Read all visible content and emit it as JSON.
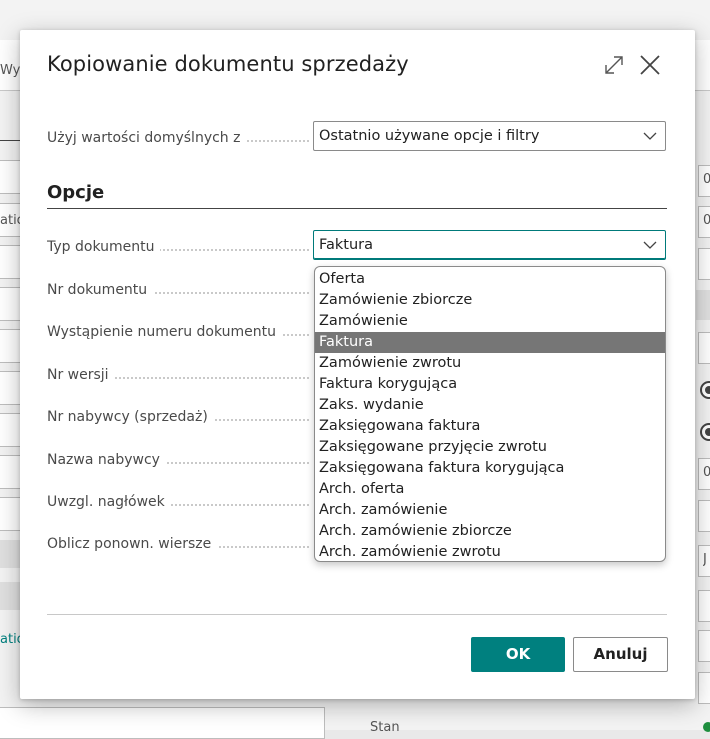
{
  "background": {
    "toolbar_text": "Wyś",
    "left_snippet_1": "atio",
    "left_snippet_2": "ation",
    "right_snippet_1": "0",
    "right_snippet_2": "0",
    "right_snippet_3": "0",
    "right_snippet_4": "J",
    "bottom_label": "Stan"
  },
  "dialog": {
    "title": "Kopiowanie dokumentu sprzedaży",
    "defaults_label": "Użyj wartości domyślnych z",
    "defaults_value": "Ostatnio używane opcje i filtry",
    "section_title": "Opcje",
    "fields": [
      {
        "label": "Typ dokumentu",
        "value": "Faktura"
      },
      {
        "label": "Nr dokumentu"
      },
      {
        "label": "Wystąpienie numeru dokumentu"
      },
      {
        "label": "Nr wersji"
      },
      {
        "label": "Nr nabywcy (sprzedaż)"
      },
      {
        "label": "Nazwa nabywcy"
      },
      {
        "label": "Uwzgl. nagłówek"
      },
      {
        "label": "Oblicz ponown. wiersze"
      }
    ],
    "ok_label": "OK",
    "cancel_label": "Anuluj"
  },
  "dropdown": {
    "selected": "Faktura",
    "options": [
      "Oferta",
      "Zamówienie zbiorcze",
      "Zamówienie",
      "Faktura",
      "Zamówienie zwrotu",
      "Faktura korygująca",
      "Zaks. wydanie",
      "Zaksięgowana faktura",
      "Zaksięgowane przyjęcie zwrotu",
      "Zaksięgowana faktura korygująca",
      "Arch. oferta",
      "Arch. zamówienie",
      "Arch. zamówienie zbiorcze",
      "Arch. zamówienie zwrotu"
    ]
  },
  "colors": {
    "primary": "#00807f",
    "selected_option": "#767676",
    "focus_border": "#007a7a"
  }
}
